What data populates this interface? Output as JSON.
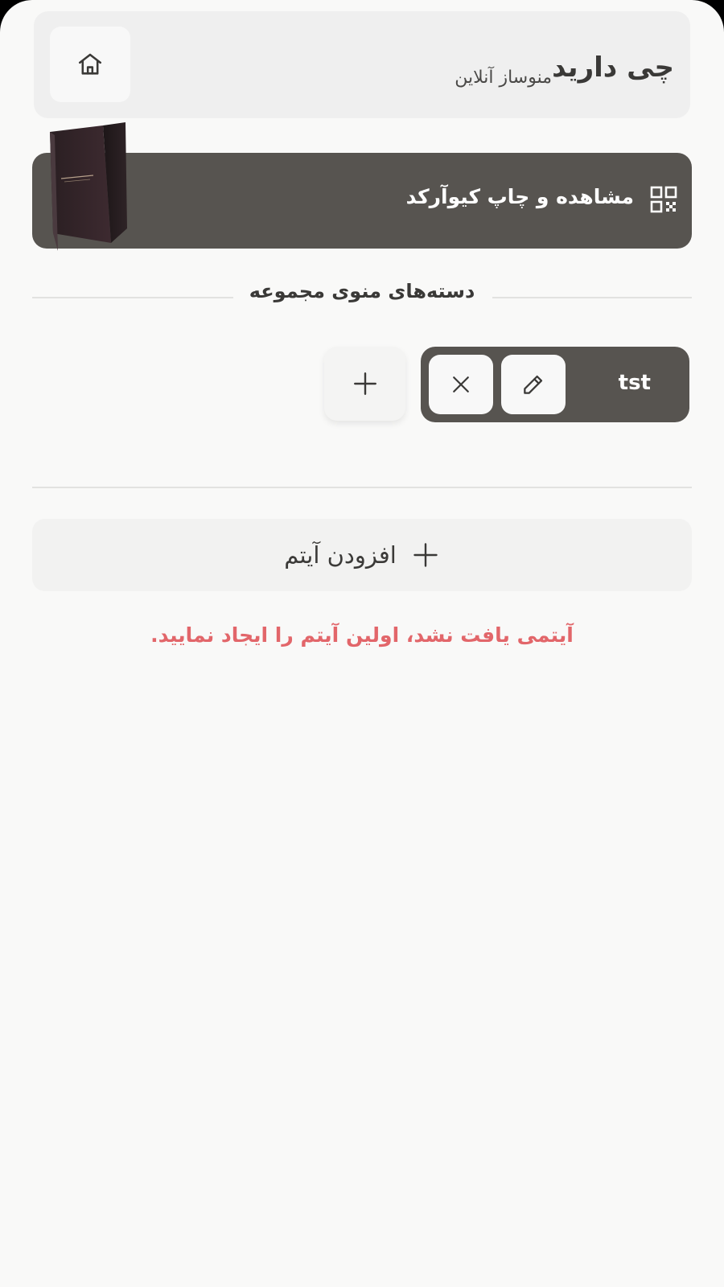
{
  "header": {
    "title": "چی دارید",
    "subtitle": "منوساز آنلاین",
    "home_icon": "home-icon"
  },
  "qr_banner": {
    "label": "مشاهده و چاپ کیوآرکد",
    "icon": "qr-code-icon"
  },
  "categories_section": {
    "title": "دسته‌های منوی مجموعه",
    "categories": [
      {
        "label": "tst",
        "edit_icon": "pencil-icon",
        "delete_icon": "close-icon"
      }
    ],
    "add_icon": "plus-icon"
  },
  "items_section": {
    "add_item_label": "افزودن آیتم",
    "add_item_icon": "plus-icon",
    "empty_message": "آیتمی یافت نشد، اولین آیتم را ایجاد نمایید."
  },
  "colors": {
    "background": "#f9f9f8",
    "header_bg": "#efefef",
    "accent_dark": "#575450",
    "error_text": "#e2666a"
  }
}
